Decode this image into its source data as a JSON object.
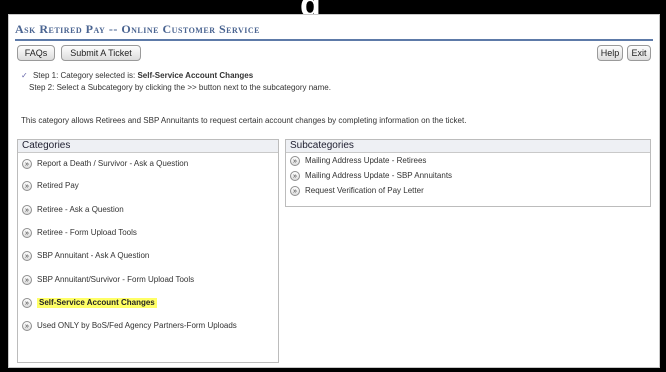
{
  "top_fragment": "g",
  "window": {
    "title": "Ask Retired Pay -- Online Customer Service"
  },
  "toolbar": {
    "faq_label": "FAQs",
    "submit_label": "Submit A Ticket",
    "help_label": "Help",
    "exit_label": "Exit"
  },
  "steps": {
    "step1_prefix": "Step 1: Category selected is:",
    "step1_selected": "Self-Service Account Changes",
    "step2": "Step 2: Select a Subcategory by clicking the >> button next to the subcategory name."
  },
  "description": "This category allows Retirees and SBP Annuitants to request certain account changes by completing information on the ticket.",
  "categories": {
    "heading": "Categories",
    "button_glyph": "»",
    "items": [
      {
        "label": "Report a Death / Survivor - Ask a Question"
      },
      {
        "label": "Retired Pay"
      },
      {
        "label": "Retiree - Ask a Question"
      },
      {
        "label": "Retiree - Form Upload Tools"
      },
      {
        "label": "SBP Annuitant - Ask A Question"
      },
      {
        "label": "SBP Annuitant/Survivor - Form Upload Tools"
      },
      {
        "label": "Self-Service Account Changes"
      },
      {
        "label": "Used ONLY by BoS/Fed Agency Partners-Form Uploads"
      }
    ]
  },
  "subcategories": {
    "heading": "Subcategories",
    "button_glyph": "»",
    "items": [
      {
        "label": "Mailing Address Update - Retirees"
      },
      {
        "label": "Mailing Address Update - SBP Annuitants"
      },
      {
        "label": "Request Verification of Pay Letter"
      }
    ]
  },
  "colors": {
    "accent": "#4a6491",
    "highlight": "#ffff66",
    "panel_header": "#eef0f4"
  }
}
